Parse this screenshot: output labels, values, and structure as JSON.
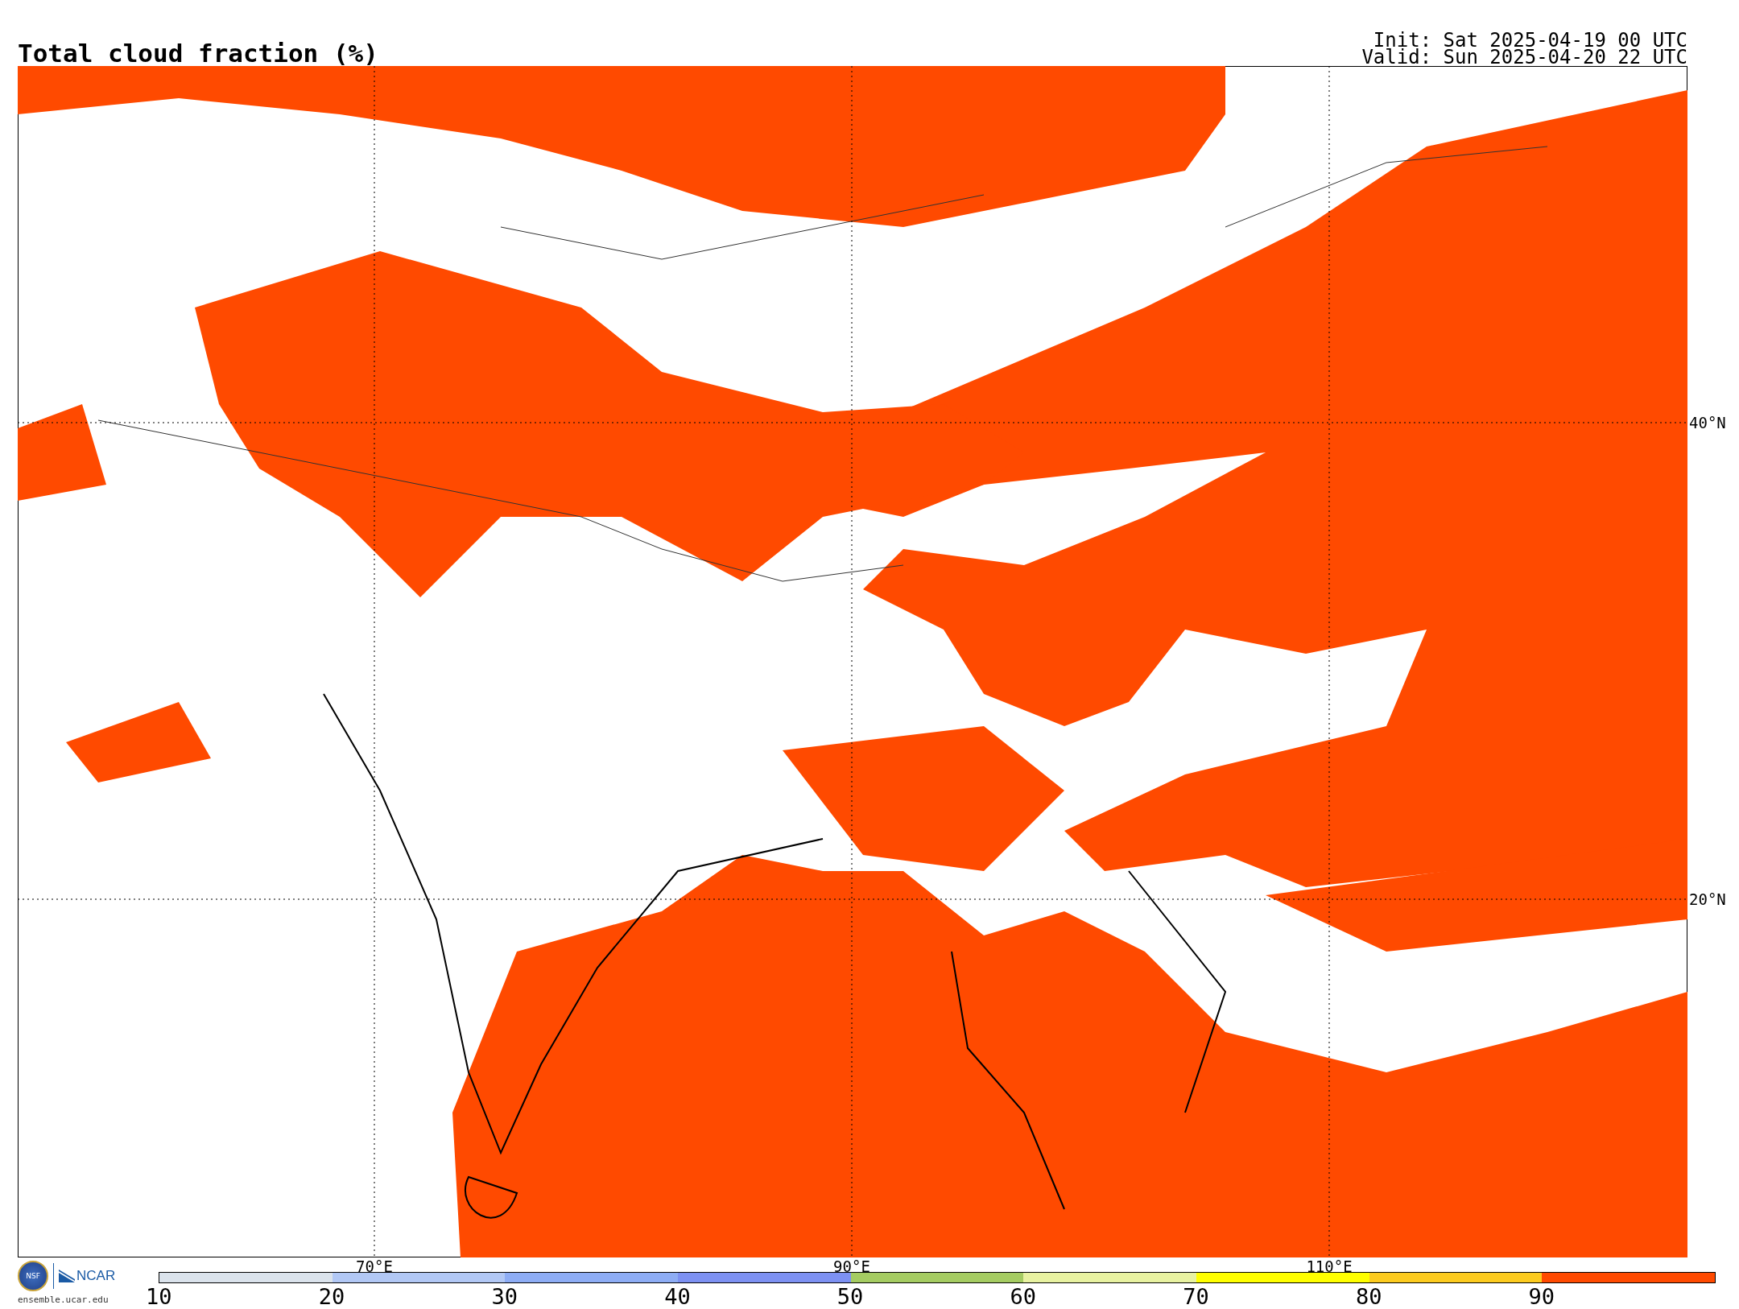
{
  "title": "Total cloud fraction (%)",
  "init": "Init: Sat 2025-04-19 00 UTC",
  "valid": "Valid: Sun 2025-04-20 22 UTC",
  "map": {
    "longitude_labels": [
      "70°E",
      "90°E",
      "110°E"
    ],
    "latitude_labels": [
      "40°N",
      "20°N"
    ]
  },
  "logo": {
    "emblem": "NSF",
    "name": "NCAR",
    "url": "ensemble.ucar.edu"
  },
  "colorbar": {
    "bins": [
      {
        "color": "#dbe3ec"
      },
      {
        "color": "#b2c8f5"
      },
      {
        "color": "#8eadf5"
      },
      {
        "color": "#7d91f2"
      },
      {
        "color": "#a5cc62"
      },
      {
        "color": "#e8f2a1"
      },
      {
        "color": "#ffff00"
      },
      {
        "color": "#fccb1f"
      },
      {
        "color": "#ff4a00"
      }
    ],
    "ticks": [
      "10",
      "20",
      "30",
      "40",
      "50",
      "60",
      "70",
      "80",
      "90"
    ]
  }
}
